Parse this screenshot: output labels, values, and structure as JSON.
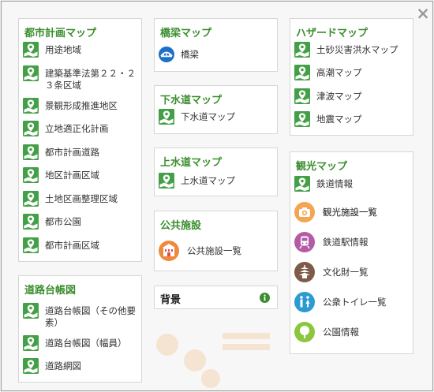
{
  "close_label": "×",
  "toshi": {
    "title": "都市計画マップ",
    "items": [
      {
        "label": "用途地域"
      },
      {
        "label": "建築基準法第２２・２３条区域"
      },
      {
        "label": "景観形成推進地区"
      },
      {
        "label": "立地適正化計画"
      },
      {
        "label": "都市計画道路"
      },
      {
        "label": "地区計画区域"
      },
      {
        "label": "土地区画整理区域"
      },
      {
        "label": "都市公園"
      },
      {
        "label": "都市計画区域"
      }
    ]
  },
  "doro": {
    "title": "道路台帳図",
    "items": [
      {
        "label": "道路台帳図（その他要素）"
      },
      {
        "label": "道路台帳図（幅員）"
      },
      {
        "label": "道路網図"
      }
    ]
  },
  "kyoryo": {
    "title": "橋梁マップ",
    "items": [
      {
        "label": "橋梁",
        "icon": "bridge-icon"
      }
    ]
  },
  "gesui": {
    "title": "下水道マップ",
    "items": [
      {
        "label": "下水道マップ"
      }
    ]
  },
  "josui": {
    "title": "上水道マップ",
    "items": [
      {
        "label": "上水道マップ"
      }
    ]
  },
  "koukyou": {
    "title": "公共施設",
    "items": [
      {
        "label": "公共施設一覧",
        "icon": "public-facility-icon"
      }
    ]
  },
  "haikei": {
    "title": "背景",
    "info_icon": "info-icon"
  },
  "hazard": {
    "title": "ハザードマップ",
    "items": [
      {
        "label": "土砂災害洪水マップ"
      },
      {
        "label": "高潮マップ"
      },
      {
        "label": "津波マップ"
      },
      {
        "label": "地震マップ"
      }
    ]
  },
  "kanko": {
    "title": "観光マップ",
    "items": [
      {
        "label": "鉄道情報",
        "icon": "map-layer-icon"
      },
      {
        "label": "観光施設一覧",
        "icon": "camera-icon",
        "color": "#f5a451"
      },
      {
        "label": "鉄道駅情報",
        "icon": "train-icon",
        "color": "#b45ba6"
      },
      {
        "label": "文化財一覧",
        "icon": "pagoda-icon",
        "color": "#7f5a48"
      },
      {
        "label": "公衆トイレ一覧",
        "icon": "restroom-icon",
        "color": "#2b9bd0"
      },
      {
        "label": "公園情報",
        "icon": "tree-icon",
        "color": "#8cc63f"
      }
    ]
  },
  "colors": {
    "accent": "#3b8e2e",
    "icon_green": "#43a047"
  }
}
